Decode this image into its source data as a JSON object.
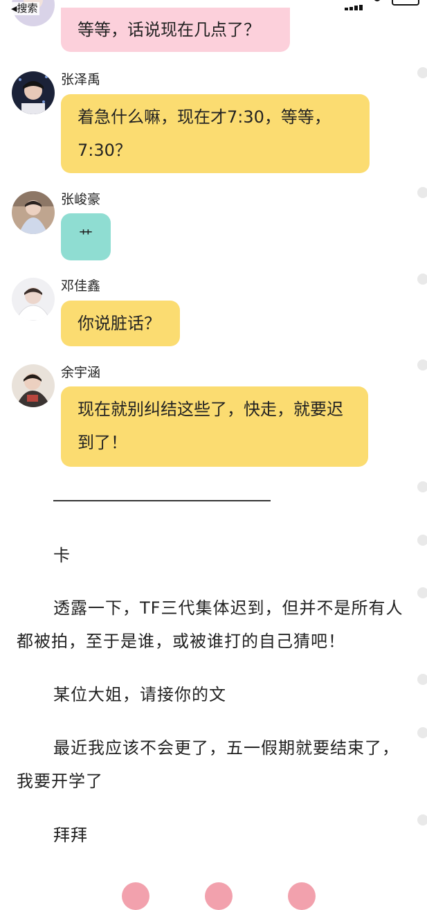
{
  "statusbar": {
    "back_label": "搜索"
  },
  "messages": [
    {
      "name": "",
      "text": "等等，话说现在几点了？",
      "color": "pink"
    },
    {
      "name": "张泽禹",
      "text": "着急什么嘛，现在才7:30，等等，7:30？",
      "color": "yellow"
    },
    {
      "name": "张峻豪",
      "text": "艹",
      "color": "teal"
    },
    {
      "name": "邓佳鑫",
      "text": "你说脏话？",
      "color": "yellow"
    },
    {
      "name": "余宇涵",
      "text": "现在就别纠结这些了，快走，就要迟到了！",
      "color": "yellow"
    }
  ],
  "article": {
    "paragraphs": [
      "卡",
      "透露一下，TF三代集体迟到，但并不是所有人都被拍，至于是谁，或被谁打的自己猜吧！",
      "某位大姐，请接你的文",
      "最近我应该不会更了，五一假期就要结束了，我要开学了",
      "拜拜"
    ]
  },
  "colors": {
    "bubble_yellow": "#fbdc71",
    "bubble_pink": "#fcd0db",
    "bubble_teal": "#8fddd2",
    "dot_gray": "#e9e9e9",
    "reaction_pink": "#f2a1ad"
  }
}
